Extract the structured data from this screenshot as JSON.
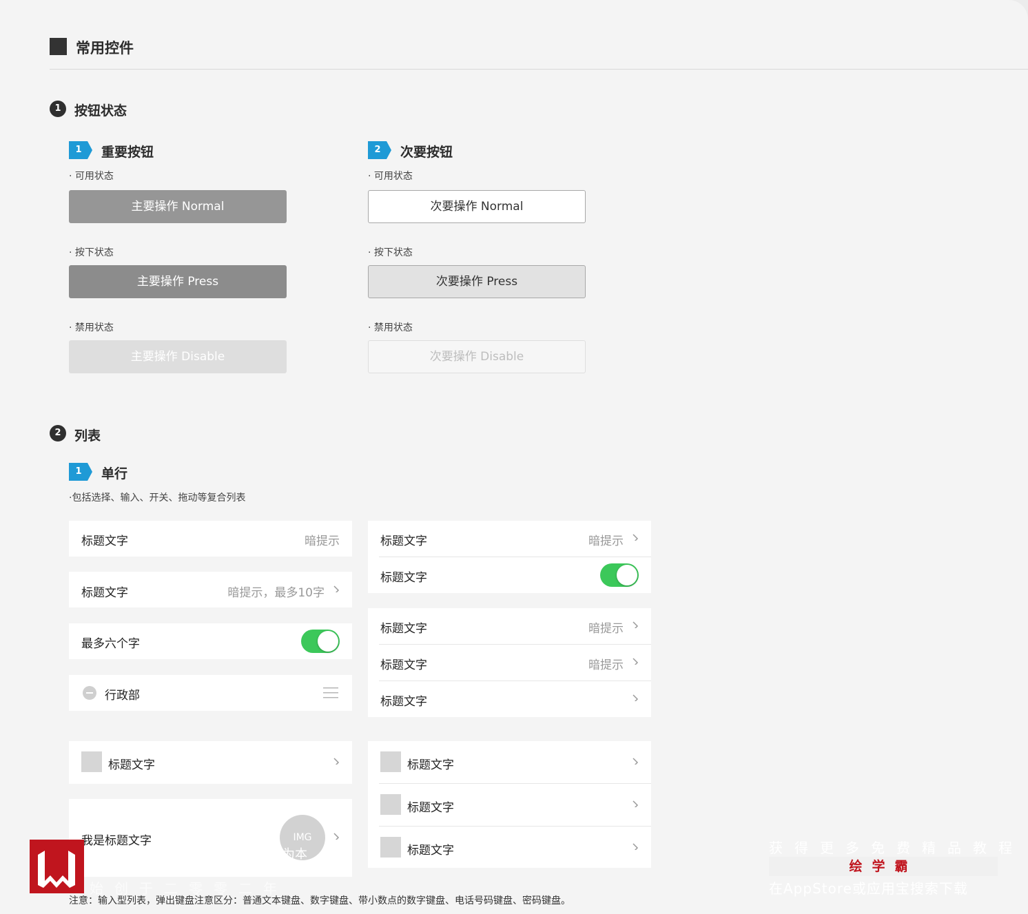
{
  "header": {
    "title": "常用控件"
  },
  "section1": {
    "num": "1",
    "title": "按钮状态",
    "primary": {
      "badge": "1",
      "title": "重要按钮",
      "normal_caption": "· 可用状态",
      "normal_label": "主要操作 Normal",
      "press_caption": "· 按下状态",
      "press_label": "主要操作 Press",
      "disable_caption": "· 禁用状态",
      "disable_label": "主要操作 Disable"
    },
    "secondary": {
      "badge": "2",
      "title": "次要按钮",
      "normal_caption": "· 可用状态",
      "normal_label": "次要操作 Normal",
      "press_caption": "· 按下状态",
      "press_label": "次要操作 Press",
      "disable_caption": "· 禁用状态",
      "disable_label": "次要操作 Disable"
    }
  },
  "section2": {
    "num": "2",
    "title": "列表",
    "sub": {
      "badge": "1",
      "title": "单行",
      "caption": "·包括选择、输入、开关、拖动等复合列表"
    },
    "left_list": [
      {
        "title": "标题文字",
        "hint": "暗提示"
      },
      {
        "title": "标题文字",
        "hint": "暗提示，最多10字"
      },
      {
        "title": "最多六个字",
        "toggle": "on"
      },
      {
        "title": "行政部"
      },
      {
        "title": "标题文字"
      },
      {
        "title": "我是标题文字",
        "img": "IMG"
      }
    ],
    "right_group1": [
      {
        "title": "标题文字",
        "hint": "暗提示"
      },
      {
        "title": "标题文字",
        "toggle": "on"
      }
    ],
    "right_group2": [
      {
        "title": "标题文字",
        "hint": "暗提示"
      },
      {
        "title": "标题文字",
        "hint": "暗提示"
      },
      {
        "title": "标题文字"
      }
    ],
    "right_group3": [
      {
        "title": "标题文字"
      },
      {
        "title": "标题文字"
      },
      {
        "title": "标题文字"
      }
    ]
  },
  "note": "注意：输入型列表，弹出键盘注意区分：普通文本键盘、数字键盘、带小数点的数字键盘、电话号码键盘、密码键盘。",
  "watermark": {
    "line1": "获得更多免费精品教程",
    "brand": "绘学霸",
    "line2": "在AppStore或应用宝搜索下载",
    "overlay_a": "为本",
    "overlay_b": "始创于二零零二年"
  },
  "colors": {
    "toggle_on": "#3cc85a",
    "badge_blue": "#1f9ad6",
    "brand_red": "#c0151e"
  }
}
